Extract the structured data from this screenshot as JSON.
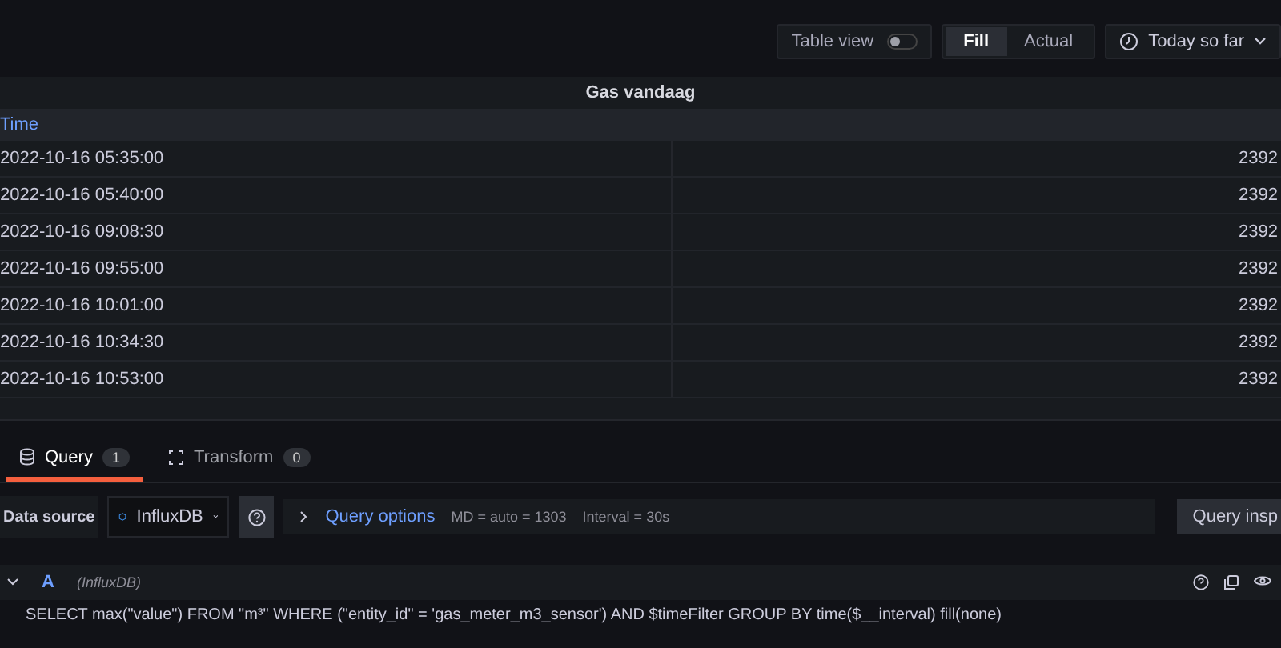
{
  "toolbar": {
    "table_view": {
      "label": "Table view",
      "on": false
    },
    "fill_modes": [
      {
        "label": "Fill",
        "selected": true
      },
      {
        "label": "Actual",
        "selected": false
      }
    ],
    "time_range": "Today so far"
  },
  "panel": {
    "title": "Gas vandaag",
    "columns": [
      "Time"
    ],
    "rows": [
      {
        "time": "2022-10-16 05:35:00",
        "value": "2392"
      },
      {
        "time": "2022-10-16 05:40:00",
        "value": "2392"
      },
      {
        "time": "2022-10-16 09:08:30",
        "value": "2392"
      },
      {
        "time": "2022-10-16 09:55:00",
        "value": "2392"
      },
      {
        "time": "2022-10-16 10:01:00",
        "value": "2392"
      },
      {
        "time": "2022-10-16 10:34:30",
        "value": "2392"
      },
      {
        "time": "2022-10-16 10:53:00",
        "value": "2392"
      }
    ]
  },
  "editor_tabs": [
    {
      "kind": "query",
      "label": "Query",
      "count": "1",
      "selected": true
    },
    {
      "kind": "transform",
      "label": "Transform",
      "count": "0",
      "selected": false
    }
  ],
  "data_source": {
    "label": "Data source",
    "name": "InfluxDB",
    "options_label": "Query options",
    "md": "MD = auto = 1303",
    "interval": "Interval = 30s",
    "inspector": "Query insp"
  },
  "queries": [
    {
      "ref": "A",
      "source": "(InfluxDB)",
      "expanded": true,
      "sql": "SELECT max(\"value\") FROM \"m³\" WHERE (\"entity_id\" = 'gas_meter_m3_sensor') AND $timeFilter GROUP BY time($__interval) fill(none)"
    }
  ]
}
